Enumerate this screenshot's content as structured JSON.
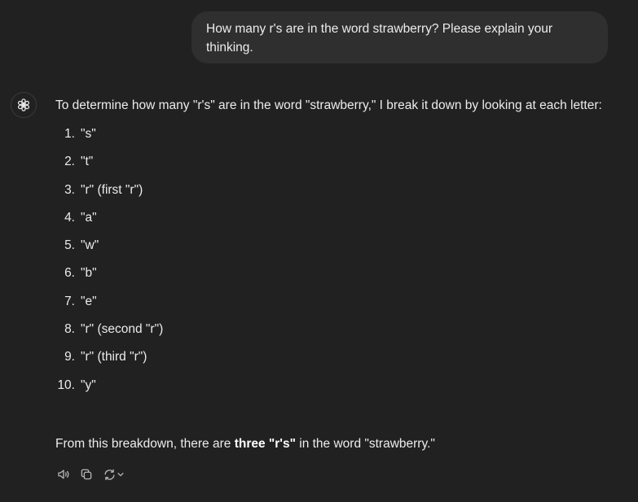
{
  "user_message": "How many r's are in the word strawberry? Please explain your thinking.",
  "assistant": {
    "avatar_icon": "openai-logo-icon",
    "intro": "To determine how many \"r's\" are in the word \"strawberry,\" I break it down by looking at each letter:",
    "letters": [
      {
        "num": "1.",
        "text": "\"s\""
      },
      {
        "num": "2.",
        "text": "\"t\""
      },
      {
        "num": "3.",
        "text": "\"r\" (first \"r\")"
      },
      {
        "num": "4.",
        "text": "\"a\""
      },
      {
        "num": "5.",
        "text": "\"w\""
      },
      {
        "num": "6.",
        "text": "\"b\""
      },
      {
        "num": "7.",
        "text": "\"e\""
      },
      {
        "num": "8.",
        "text": "\"r\" (second \"r\")"
      },
      {
        "num": "9.",
        "text": "\"r\" (third \"r\")"
      },
      {
        "num": "10.",
        "text": "\"y\""
      }
    ],
    "summary": {
      "before": "From this breakdown, there are ",
      "bold": "three \"r's\"",
      "after": " in the word \"strawberry.\""
    }
  },
  "actions": [
    {
      "name": "read-aloud",
      "icon": "speaker-icon"
    },
    {
      "name": "copy",
      "icon": "copy-icon"
    },
    {
      "name": "regenerate",
      "icon": "refresh-icon"
    }
  ],
  "colors": {
    "background": "#212121",
    "bubble": "#2f2f2f",
    "text": "#ececec",
    "icon": "#b4b4b4"
  }
}
